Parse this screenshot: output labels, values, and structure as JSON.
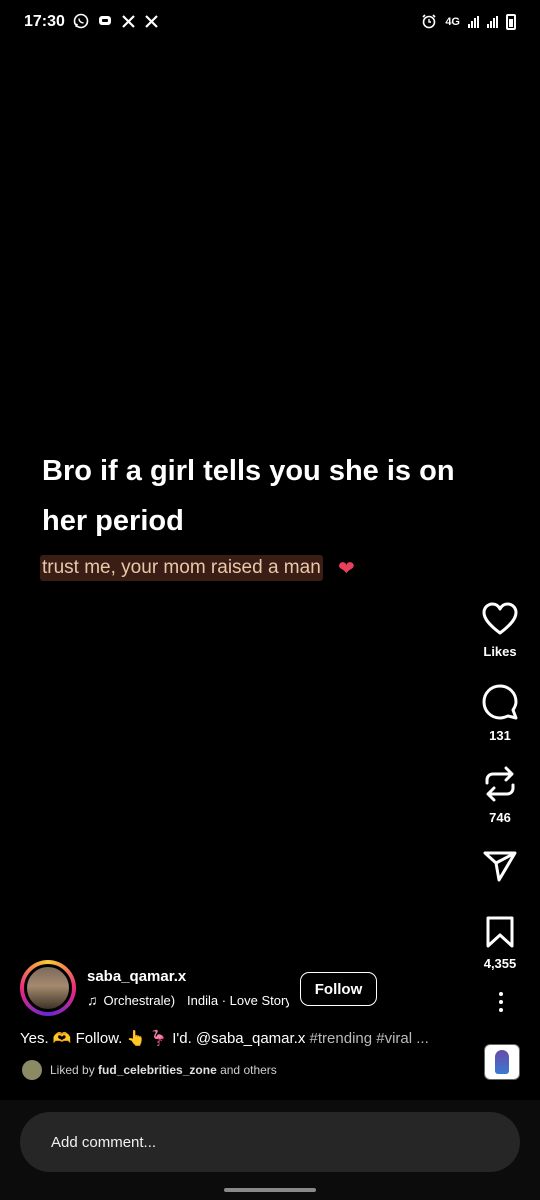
{
  "status_bar": {
    "time": "17:30",
    "network": "4G",
    "app_icons": [
      "whatsapp-icon",
      "message-icon",
      "x-icon",
      "x-icon"
    ]
  },
  "post": {
    "headline": "Bro if a girl tells you she is on her period",
    "subline": "trust me, your mom raised a man"
  },
  "actions": {
    "likes_label": "Likes",
    "comments_count": "131",
    "reposts_count": "746",
    "saves_count": "4,355"
  },
  "author": {
    "username": "saba_qamar.x",
    "audio_track": "Orchestrale)",
    "audio_artist": "Indila · Love Story",
    "follow_label": "Follow"
  },
  "caption": {
    "text": "Yes. 🫶 Follow. 👆 🦩 I'd. @saba_qamar.x ",
    "tags": "#trending #viral ..."
  },
  "liked_by": {
    "prefix": "Liked by ",
    "user": "fud_celebrities_zone",
    "suffix": " and others"
  },
  "comment": {
    "placeholder": "Add comment..."
  },
  "colors": {
    "background": "#000000",
    "subline_bg": "#3a1d14",
    "subline_text": "#e9c8a8",
    "input_bg": "#262626"
  }
}
